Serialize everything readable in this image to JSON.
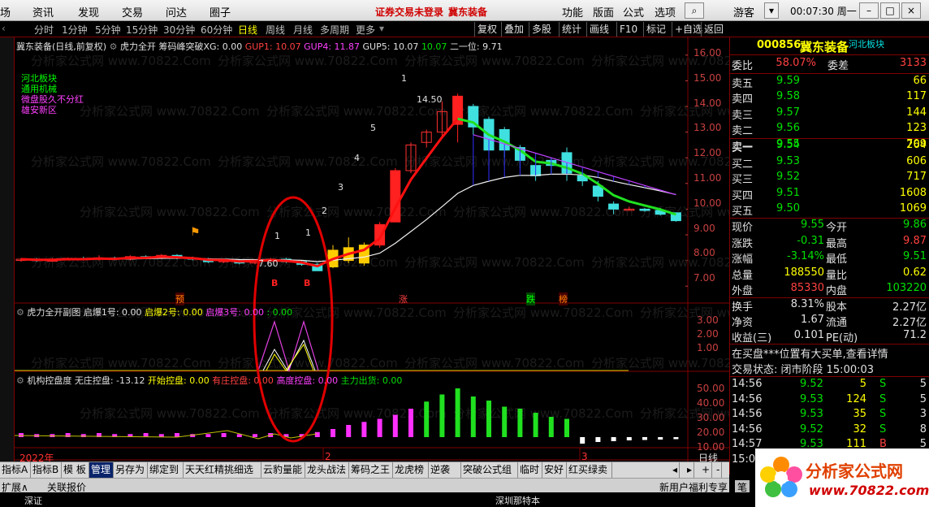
{
  "menubar": {
    "left_cut": "场",
    "items": [
      "资讯",
      "发现",
      "交易",
      "问达",
      "圈子"
    ],
    "warning": "证券交易未登录",
    "stock_name": "冀东装备",
    "right_items": [
      "功能",
      "版面",
      "公式",
      "选项"
    ],
    "user": "游客",
    "clock": "00:07:30 周一"
  },
  "toolbar": {
    "periods": [
      "分时",
      "1分钟",
      "5分钟",
      "15分钟",
      "30分钟",
      "60分钟",
      "日线",
      "周线",
      "月线",
      "多周期",
      "更多"
    ],
    "selected": "日线",
    "right_buttons": [
      "复权",
      "叠加",
      "多股",
      "统计",
      "画线",
      "F10",
      "标记",
      "+自选",
      "返回"
    ]
  },
  "main_info": {
    "title": "冀东装备(日线,前复权)",
    "formula": "虎力全开",
    "xg": "筹码峰突破XG: 0.00",
    "gup1": "GUP1: 10.07",
    "gup4": "GUP4: 11.87",
    "gup5": "GUP5: 10.07",
    "gup5b": "10.07",
    "second": "二一位: 9.71"
  },
  "tags": [
    "河北板块",
    "通用机械",
    "微盘股久不分红",
    "雄安新区"
  ],
  "price_axis": [
    "16.00",
    "15.00",
    "14.00",
    "13.00",
    "12.00",
    "11.00",
    "10.00",
    "9.00",
    "8.00",
    "7.00"
  ],
  "annotations": {
    "high": "14.50",
    "low": "7.60",
    "nums": [
      "1",
      "2",
      "3",
      "4",
      "5",
      "1",
      "1"
    ],
    "markers": [
      "预",
      "涨",
      "跌",
      "榜"
    ],
    "b_marks": [
      "B",
      "B"
    ]
  },
  "sub1": {
    "title": "虎力全开副图",
    "v1": "启爆1号: 0.00",
    "v2": "启爆2号: 0.00",
    "v3": "启爆3号: 0.00",
    "v4": ": 0.00",
    "axis": [
      "3.00",
      "2.00",
      "1.00"
    ]
  },
  "sub2": {
    "title": "机构控盘度",
    "v1": "无庄控盘: -13.12",
    "v2": "开始控盘: 0.00",
    "v3": "有庄控盘: 0.00",
    "v4": "高度控盘: 0.00",
    "v5": "主力出货: 0.00",
    "axis": [
      "50.00",
      "40.00",
      "30.00",
      "20.00",
      "10.00"
    ]
  },
  "x_axis": {
    "year": "2022年",
    "m2": "2",
    "m3": "3",
    "unit": "日线"
  },
  "chart_data": {
    "type": "candlestick",
    "ylim": [
      6.5,
      16.5
    ],
    "candles": [
      [
        8.0,
        8.05,
        7.95,
        8.1
      ],
      [
        8.05,
        8.0,
        7.95,
        8.1
      ],
      [
        8.0,
        8.02,
        7.95,
        8.1
      ],
      [
        8.02,
        8.08,
        8.0,
        8.12
      ],
      [
        8.08,
        8.05,
        8.0,
        8.15
      ],
      [
        8.05,
        8.1,
        8.0,
        8.2
      ],
      [
        8.1,
        8.05,
        8.0,
        8.15
      ],
      [
        8.05,
        8.15,
        8.0,
        8.2
      ],
      [
        8.15,
        8.1,
        8.05,
        8.2
      ],
      [
        8.1,
        8.2,
        8.05,
        8.25
      ],
      [
        8.2,
        8.1,
        8.05,
        8.25
      ],
      [
        8.1,
        8.05,
        8.0,
        8.15
      ],
      [
        8.05,
        7.95,
        7.9,
        8.1
      ],
      [
        7.95,
        8.0,
        7.9,
        8.05
      ],
      [
        8.0,
        7.9,
        7.85,
        8.05
      ],
      [
        7.9,
        8.0,
        7.85,
        8.05
      ],
      [
        8.0,
        8.05,
        7.95,
        8.1
      ],
      [
        8.05,
        7.95,
        7.9,
        8.1
      ],
      [
        7.95,
        7.85,
        7.8,
        8.0
      ],
      [
        7.85,
        7.6,
        7.6,
        7.9
      ],
      [
        7.75,
        8.4,
        7.7,
        8.6
      ],
      [
        8.0,
        8.5,
        7.9,
        8.9
      ],
      [
        7.9,
        8.6,
        7.8,
        8.7
      ],
      [
        8.6,
        9.4,
        8.5,
        9.5
      ],
      [
        9.5,
        11.5,
        9.5,
        11.6
      ],
      [
        11.5,
        12.5,
        11.4,
        12.6
      ],
      [
        12.6,
        13.0,
        12.4,
        13.1
      ],
      [
        13.0,
        13.8,
        12.8,
        14.2
      ],
      [
        13.3,
        14.4,
        12.6,
        14.5
      ],
      [
        14.0,
        13.2,
        12.9,
        14.1
      ],
      [
        13.5,
        12.3,
        12.0,
        13.6
      ],
      [
        13.1,
        12.3,
        12.0,
        13.2
      ],
      [
        12.4,
        11.9,
        11.6,
        12.5
      ],
      [
        11.7,
        11.3,
        11.1,
        11.8
      ],
      [
        11.9,
        11.7,
        11.4,
        12.0
      ],
      [
        12.2,
        11.4,
        11.1,
        12.4
      ],
      [
        11.3,
        11.1,
        10.9,
        11.4
      ],
      [
        10.9,
        10.5,
        10.3,
        11.1
      ],
      [
        10.2,
        10.0,
        9.8,
        10.3
      ],
      [
        10.0,
        10.0,
        9.95,
        10.1
      ],
      [
        10.0,
        9.95,
        9.9,
        10.05
      ],
      [
        9.95,
        9.8,
        9.75,
        10.05
      ],
      [
        9.86,
        9.55,
        9.51,
        9.87
      ]
    ],
    "vol": [
      4,
      3,
      3,
      4,
      3,
      4,
      3,
      3,
      4,
      3,
      4,
      3,
      3,
      4,
      3,
      3,
      4,
      3,
      3,
      5,
      8,
      12,
      15,
      18,
      22,
      28,
      35,
      42,
      48,
      40,
      36,
      30,
      28,
      24,
      20,
      18,
      16,
      12,
      10,
      8,
      7,
      6,
      5
    ]
  },
  "rp": {
    "code": "000856",
    "name": "冀东装备",
    "sector": "河北板块",
    "wb_label": "委比",
    "wb": "58.07%",
    "wc_label": "委差",
    "wc": "3133",
    "asks": [
      {
        "label": "卖五",
        "price": "9.59",
        "vol": "66"
      },
      {
        "label": "卖四",
        "price": "9.58",
        "vol": "117"
      },
      {
        "label": "卖三",
        "price": "9.57",
        "vol": "144"
      },
      {
        "label": "卖二",
        "price": "9.56",
        "vol": "123"
      },
      {
        "label": "卖一",
        "price": "9.55",
        "vol": "709"
      }
    ],
    "bids": [
      {
        "label": "买一",
        "price": "9.54",
        "vol": "264"
      },
      {
        "label": "买二",
        "price": "9.53",
        "vol": "606"
      },
      {
        "label": "买三",
        "price": "9.52",
        "vol": "717"
      },
      {
        "label": "买四",
        "price": "9.51",
        "vol": "1608"
      },
      {
        "label": "买五",
        "price": "9.50",
        "vol": "1069"
      }
    ],
    "stats": [
      {
        "l": "现价",
        "v": "9.55",
        "l2": "今开",
        "v2": "9.86"
      },
      {
        "l": "涨跌",
        "v": "-0.31",
        "l2": "最高",
        "v2": "9.87"
      },
      {
        "l": "涨幅",
        "v": "-3.14%",
        "l2": "最低",
        "v2": "9.51"
      },
      {
        "l": "总量",
        "v": "188550",
        "l2": "量比",
        "v2": "0.62"
      },
      {
        "l": "外盘",
        "v": "85330",
        "l2": "内盘",
        "v2": "103220"
      }
    ],
    "stats2": [
      {
        "l": "换手",
        "v": "8.31%",
        "l2": "股本",
        "v2": "2.27亿"
      },
      {
        "l": "净资",
        "v": "1.67",
        "l2": "流通",
        "v2": "2.27亿"
      },
      {
        "l": "收益(三)",
        "v": "0.101",
        "l2": "PE(动)",
        "v2": "71.2"
      }
    ],
    "notice": "在买盘***位置有大买单,查看详情",
    "trade_status": "交易状态: 闭市阶段 15:00:03",
    "ticks": [
      {
        "t": "14:56",
        "p": "9.52",
        "v": "5",
        "d": "S",
        "n": "5"
      },
      {
        "t": "14:56",
        "p": "9.53",
        "v": "124",
        "d": "S",
        "n": "5"
      },
      {
        "t": "14:56",
        "p": "9.53",
        "v": "35",
        "d": "S",
        "n": "3"
      },
      {
        "t": "14:56",
        "p": "9.52",
        "v": "32",
        "d": "S",
        "n": "8"
      },
      {
        "t": "14:57",
        "p": "9.53",
        "v": "111",
        "d": "B",
        "n": "5"
      },
      {
        "t": "15:00",
        "p": "",
        "v": "",
        "d": "",
        "n": ""
      }
    ]
  },
  "tabs": [
    "指标A",
    "指标B",
    "模 板",
    "管理",
    "另存为",
    "绑定到",
    "天天红精挑细选",
    "云豹量能",
    "龙头战法",
    "筹码之王",
    "龙虎榜",
    "逆袭者",
    "突破公式组",
    "临时",
    "安好",
    "红买绿卖"
  ],
  "tabs_selected": "管理",
  "status": {
    "expand": "扩展∧",
    "related": "关联报价",
    "notice": "新用户福利专享",
    "pen": "笔"
  },
  "logo": {
    "text": "分析家公式网",
    "url": "www.70822.com"
  },
  "bottom": {
    "left": "深证",
    "right": "深圳那特本"
  }
}
